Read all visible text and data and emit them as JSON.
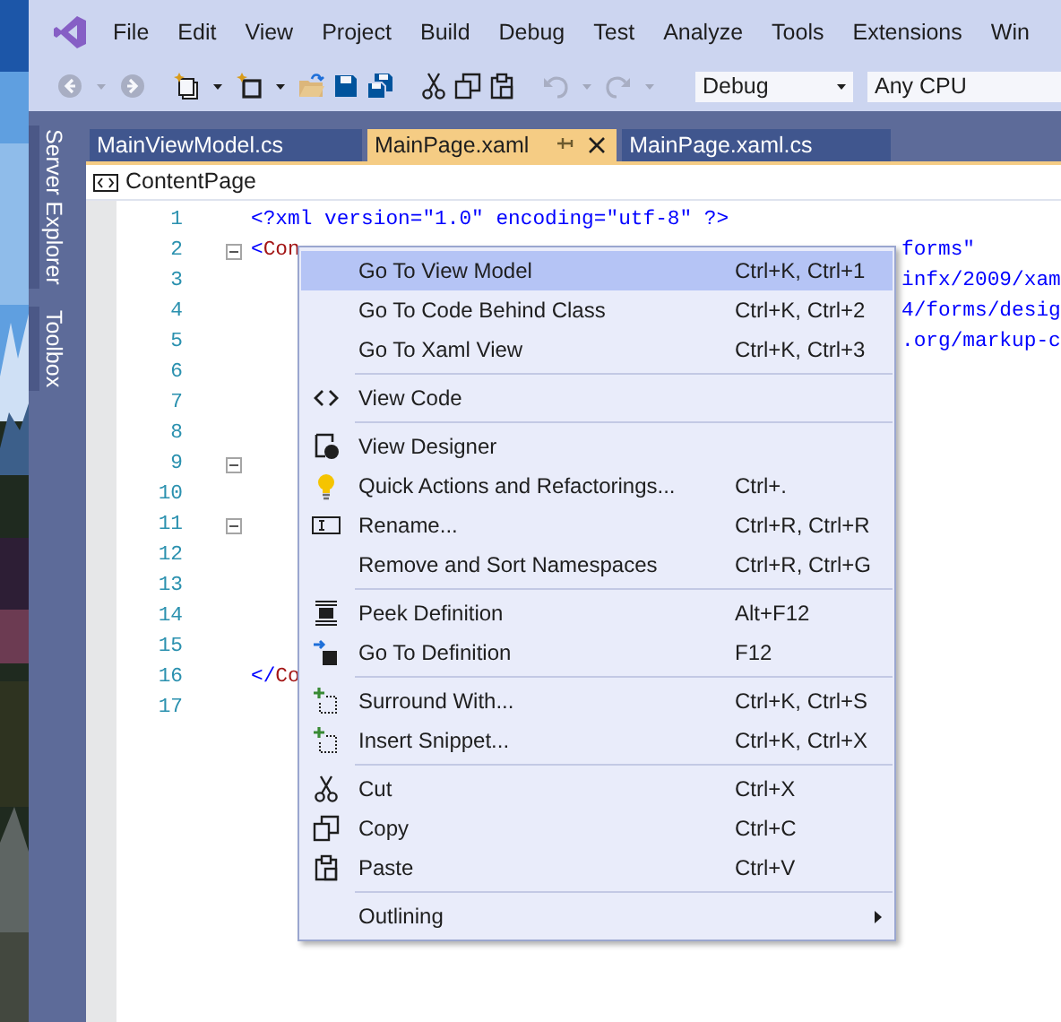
{
  "menu_bar": {
    "items": [
      "File",
      "Edit",
      "View",
      "Project",
      "Build",
      "Debug",
      "Test",
      "Analyze",
      "Tools",
      "Extensions",
      "Win"
    ]
  },
  "toolbar": {
    "items": [
      {
        "kind": "button",
        "disabled": true,
        "dropdown": true
      },
      {
        "kind": "button",
        "disabled": true,
        "dropdown": false
      },
      {
        "kind": "separator"
      },
      {
        "kind": "button",
        "disabled": false,
        "dropdown": true
      },
      {
        "kind": "button",
        "disabled": false,
        "dropdown": true
      },
      {
        "kind": "button",
        "disabled": false,
        "dropdown": false
      },
      {
        "kind": "button",
        "disabled": false,
        "dropdown": false
      },
      {
        "kind": "button",
        "disabled": false,
        "dropdown": false
      },
      {
        "kind": "separator"
      },
      {
        "kind": "button",
        "disabled": false,
        "dropdown": false
      },
      {
        "kind": "button",
        "disabled": false,
        "dropdown": false
      },
      {
        "kind": "button",
        "disabled": false,
        "dropdown": false
      },
      {
        "kind": "separator"
      },
      {
        "kind": "button",
        "disabled": true,
        "dropdown": true
      },
      {
        "kind": "button",
        "disabled": true,
        "dropdown": true
      },
      {
        "kind": "separator"
      }
    ],
    "configuration": "Debug",
    "platform": "Any CPU"
  },
  "side_tabs": [
    {
      "label": "Server Explorer"
    },
    {
      "label": "Toolbox"
    }
  ],
  "doc_tabs": [
    {
      "label": "MainViewModel.cs",
      "selected": false
    },
    {
      "label": "MainPage.xaml",
      "selected": true
    },
    {
      "label": "MainPage.xaml.cs",
      "selected": false
    }
  ],
  "nav_bar": {
    "label": "ContentPage"
  },
  "editor": {
    "lines": [
      {
        "number": "1",
        "segments": [
          {
            "text": "<?xml version=\"1.0\" encoding=\"utf-8\" ?>",
            "kind": "punct"
          }
        ]
      },
      {
        "number": "2",
        "fold": {
          "expanded": true
        },
        "segments": [
          {
            "text": "<",
            "kind": "punct"
          },
          {
            "text": "Con",
            "kind": "element"
          }
        ],
        "tail": "forms\""
      },
      {
        "number": "3",
        "tail": "infx/2009/xam"
      },
      {
        "number": "4",
        "tail": "4/forms/desig"
      },
      {
        "number": "5",
        "tail": ".org/markup-c"
      },
      {
        "number": "6"
      },
      {
        "number": "7"
      },
      {
        "number": "8"
      },
      {
        "number": "9",
        "fold": {
          "expanded": true
        }
      },
      {
        "number": "10"
      },
      {
        "number": "11",
        "fold": {
          "expanded": true
        }
      },
      {
        "number": "12"
      },
      {
        "number": "13"
      },
      {
        "number": "14"
      },
      {
        "number": "15"
      },
      {
        "number": "16",
        "segments": [
          {
            "text": "</",
            "kind": "punct"
          },
          {
            "text": "Co",
            "kind": "element"
          }
        ]
      },
      {
        "number": "17"
      }
    ]
  },
  "context_menu": {
    "items": [
      {
        "kind": "item",
        "label": "Go To View Model",
        "shortcut": "Ctrl+K, Ctrl+1",
        "selected": true
      },
      {
        "kind": "item",
        "label": "Go To Code Behind Class",
        "shortcut": "Ctrl+K, Ctrl+2",
        "selected": false
      },
      {
        "kind": "item",
        "label": "Go To Xaml View",
        "shortcut": "Ctrl+K, Ctrl+3",
        "selected": false
      },
      {
        "kind": "separator"
      },
      {
        "kind": "item",
        "label": "View Code",
        "selected": false
      },
      {
        "kind": "separator"
      },
      {
        "kind": "item",
        "label": "View Designer",
        "selected": false
      },
      {
        "kind": "item",
        "label": "Quick Actions and Refactorings...",
        "shortcut": "Ctrl+.",
        "selected": false
      },
      {
        "kind": "item",
        "label": "Rename...",
        "shortcut": "Ctrl+R, Ctrl+R",
        "selected": false
      },
      {
        "kind": "item",
        "label": "Remove and Sort Namespaces",
        "shortcut": "Ctrl+R, Ctrl+G",
        "selected": false
      },
      {
        "kind": "separator"
      },
      {
        "kind": "item",
        "label": "Peek Definition",
        "shortcut": "Alt+F12",
        "selected": false
      },
      {
        "kind": "item",
        "label": "Go To Definition",
        "shortcut": "F12",
        "selected": false
      },
      {
        "kind": "separator"
      },
      {
        "kind": "item",
        "label": "Surround With...",
        "shortcut": "Ctrl+K, Ctrl+S",
        "selected": false
      },
      {
        "kind": "item",
        "label": "Insert Snippet...",
        "shortcut": "Ctrl+K, Ctrl+X",
        "selected": false
      },
      {
        "kind": "separator"
      },
      {
        "kind": "item",
        "label": "Cut",
        "shortcut": "Ctrl+X",
        "selected": false
      },
      {
        "kind": "item",
        "label": "Copy",
        "shortcut": "Ctrl+C",
        "selected": false
      },
      {
        "kind": "item",
        "label": "Paste",
        "shortcut": "Ctrl+V",
        "selected": false
      },
      {
        "kind": "separator"
      },
      {
        "kind": "item",
        "label": "Outlining",
        "submenu": true,
        "selected": false
      }
    ]
  }
}
